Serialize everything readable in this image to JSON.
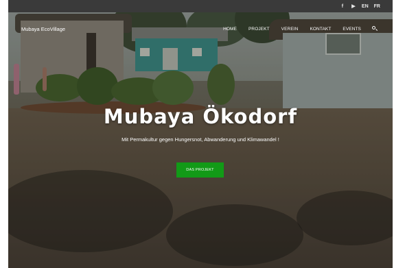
{
  "topbar": {
    "facebook_icon": "f",
    "youtube_icon": "▶",
    "lang_en": "EN",
    "lang_fr": "FR"
  },
  "nav": {
    "brand": "Mubaya EcoVillage",
    "items": [
      {
        "label": "HOME"
      },
      {
        "label": "PROJEKT"
      },
      {
        "label": "VEREIN"
      },
      {
        "label": "KONTAKT"
      },
      {
        "label": "EVENTS"
      }
    ]
  },
  "hero": {
    "title": "Mubaya Ökodorf",
    "subtitle": "Mit Permakultur gegen Hungersnot, Abwanderung und Klimawandel !",
    "cta_label": "DAS PROJEKT"
  },
  "colors": {
    "accent_green": "#129a17",
    "topbar": "#3a3a3a",
    "text": "#ffffff"
  }
}
